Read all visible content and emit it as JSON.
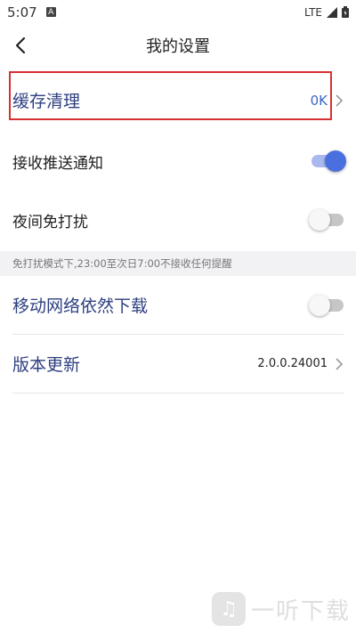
{
  "status_bar": {
    "time": "5:07",
    "network": "LTE"
  },
  "header": {
    "title": "我的设置"
  },
  "settings": {
    "cache": {
      "label": "缓存清理",
      "value": "0K"
    },
    "push": {
      "label": "接收推送通知",
      "enabled": true
    },
    "night": {
      "label": "夜间免打扰",
      "enabled": false
    },
    "note": "免打扰模式下,23:00至次日7:00不接收任何提醒",
    "mobile_download": {
      "label": "移动网络依然下载",
      "enabled": false
    },
    "version": {
      "label": "版本更新",
      "value": "2.0.0.24001"
    }
  },
  "watermark": {
    "text": "一听下载"
  },
  "colors": {
    "accent": "#4a70e0",
    "highlight_box": "#d83030",
    "label_blue": "#2e3f80"
  }
}
